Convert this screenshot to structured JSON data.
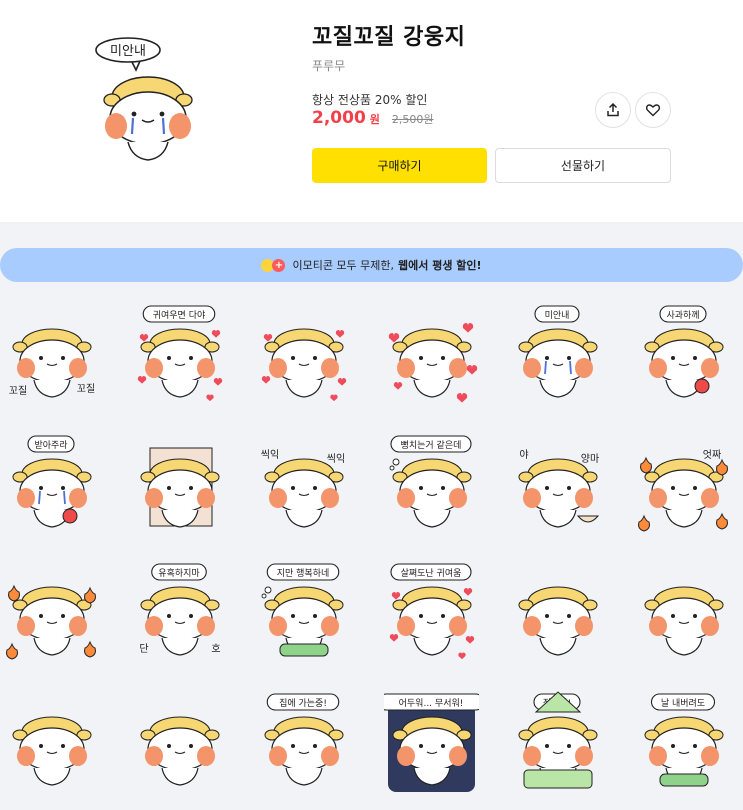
{
  "product": {
    "title": "꼬질꼬질 강웅지",
    "author": "푸루무",
    "promo": "항상 전상품 20% 할인",
    "price": "2,000",
    "currency": "원",
    "original_price": "2,500원",
    "thumbnail_bubble": "미안내"
  },
  "actions": {
    "buy_label": "구매하기",
    "gift_label": "선물하기",
    "share_icon": "share-icon",
    "like_icon": "heart-icon"
  },
  "banner": {
    "prefix": "이모티콘 모두 무제한,",
    "highlight": "웹에서 평생 할인!"
  },
  "emoticons": [
    {
      "bubble": "",
      "side_text": [
        "꼬질",
        "꼬질"
      ],
      "deco": "none"
    },
    {
      "bubble": "귀여우면 다야",
      "deco": "hearts"
    },
    {
      "bubble": "",
      "deco": "hearts"
    },
    {
      "bubble": "",
      "deco": "big-hearts"
    },
    {
      "bubble": "미안내",
      "deco": "tears"
    },
    {
      "bubble": "사과하께",
      "deco": "apple"
    },
    {
      "bubble": "받아주라",
      "deco": "apple-tears"
    },
    {
      "bubble": "",
      "deco": "bed"
    },
    {
      "bubble": "",
      "side_text": [
        "씩익",
        "씩익"
      ],
      "deco": "angry"
    },
    {
      "bubble": "뻥치는거 같은데",
      "deco": "thought"
    },
    {
      "bubble": "",
      "side_text": [
        "야",
        "양마"
      ],
      "deco": "bowl"
    },
    {
      "bubble": "",
      "side_text": [
        "엇짜"
      ],
      "deco": "fire"
    },
    {
      "bubble": "",
      "deco": "fire"
    },
    {
      "bubble": "유혹하지마",
      "side_text": [
        "단",
        "호"
      ],
      "deco": "none"
    },
    {
      "bubble": "지만 행복하네",
      "deco": "thought-green"
    },
    {
      "bubble": "살쪄도난 귀여움",
      "deco": "hearts-small"
    },
    {
      "bubble": "",
      "deco": "lean"
    },
    {
      "bubble": "",
      "deco": "peek"
    },
    {
      "bubble": "",
      "deco": "wave"
    },
    {
      "bubble": "",
      "deco": "book"
    },
    {
      "bubble": "집에 가는중!",
      "deco": "walk"
    },
    {
      "bubble": "어두워... 무서워!",
      "deco": "dark"
    },
    {
      "bubble": "집도착!",
      "deco": "blanket"
    },
    {
      "bubble": "날 내버려도",
      "deco": "blanket-green"
    }
  ],
  "colors": {
    "accent": "#ffe000",
    "price": "#f2404a",
    "banner": "#a9ccff",
    "hair": "#f7d774",
    "cheek": "#f4946a",
    "heart": "#ee4b5b"
  }
}
